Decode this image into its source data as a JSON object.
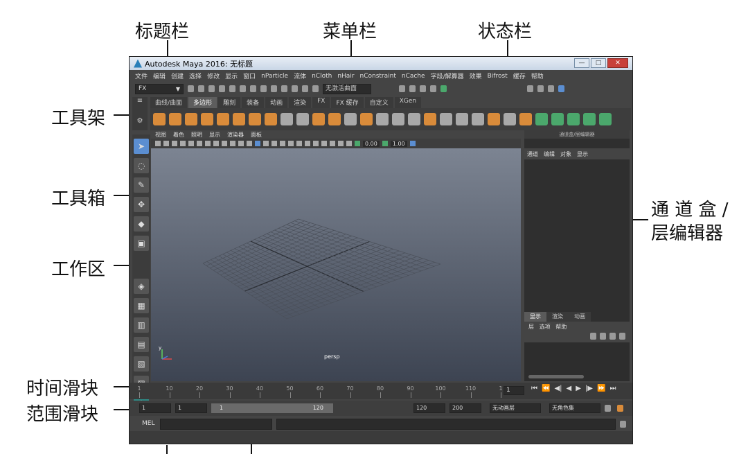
{
  "callouts": {
    "title_bar": "标题栏",
    "menu_bar": "菜单栏",
    "status_bar": "状态栏",
    "shelf": "工具架",
    "toolbox": "工具箱",
    "workspace": "工作区",
    "time_slider": "时间滑块",
    "range_slider": "范围滑块",
    "channel_box_line1": "通 道 盒 /",
    "channel_box_line2": "层编辑器"
  },
  "window": {
    "title": "Autodesk Maya 2016: 无标题",
    "controls": [
      "—",
      "□",
      "✕"
    ]
  },
  "menubar": {
    "items": [
      "文件",
      "编辑",
      "创建",
      "选择",
      "修改",
      "显示",
      "窗口",
      "nParticle",
      "流体",
      "nCloth",
      "nHair",
      "nConstraint",
      "nCache",
      "字段/解算器",
      "效果",
      "Bifrost",
      "缓存",
      "帮助"
    ]
  },
  "statusline": {
    "menuset": "FX",
    "live_surface": "无激活曲面"
  },
  "shelf": {
    "tabs": [
      "曲线/曲面",
      "多边形",
      "雕刻",
      "装备",
      "动画",
      "渲染",
      "FX",
      "FX 缓存",
      "自定义",
      "XGen"
    ],
    "active_tab": "多边形"
  },
  "viewport": {
    "menu": [
      "视图",
      "着色",
      "照明",
      "显示",
      "渲染器",
      "面板"
    ],
    "val_a": "0.00",
    "val_b": "1.00",
    "camera": "persp",
    "axis_label": "y"
  },
  "channel_box": {
    "header": "通道盒/层编辑器",
    "menu": [
      "通道",
      "编辑",
      "对象",
      "显示"
    ],
    "layer_tabs": [
      "显示",
      "渲染",
      "动画"
    ],
    "layer_menu": [
      "层",
      "选项",
      "帮助"
    ]
  },
  "time_slider": {
    "ticks": [
      "1",
      "10",
      "20",
      "30",
      "40",
      "50",
      "60",
      "70",
      "80",
      "90",
      "100",
      "110",
      "1"
    ],
    "current_frame": "1"
  },
  "range_slider": {
    "start": "1",
    "playback_start": "1",
    "bar_start": "1",
    "bar_end": "120",
    "playback_end": "120",
    "end": "200",
    "anim_layer": "无动画层",
    "character": "无角色集"
  },
  "command_line": {
    "label": "MEL"
  },
  "colors": {
    "ui_bg": "#444444",
    "active_tool": "#5b8ed1",
    "shelf_orange": "#d98b3a",
    "shelf_green": "#4ba86c"
  }
}
